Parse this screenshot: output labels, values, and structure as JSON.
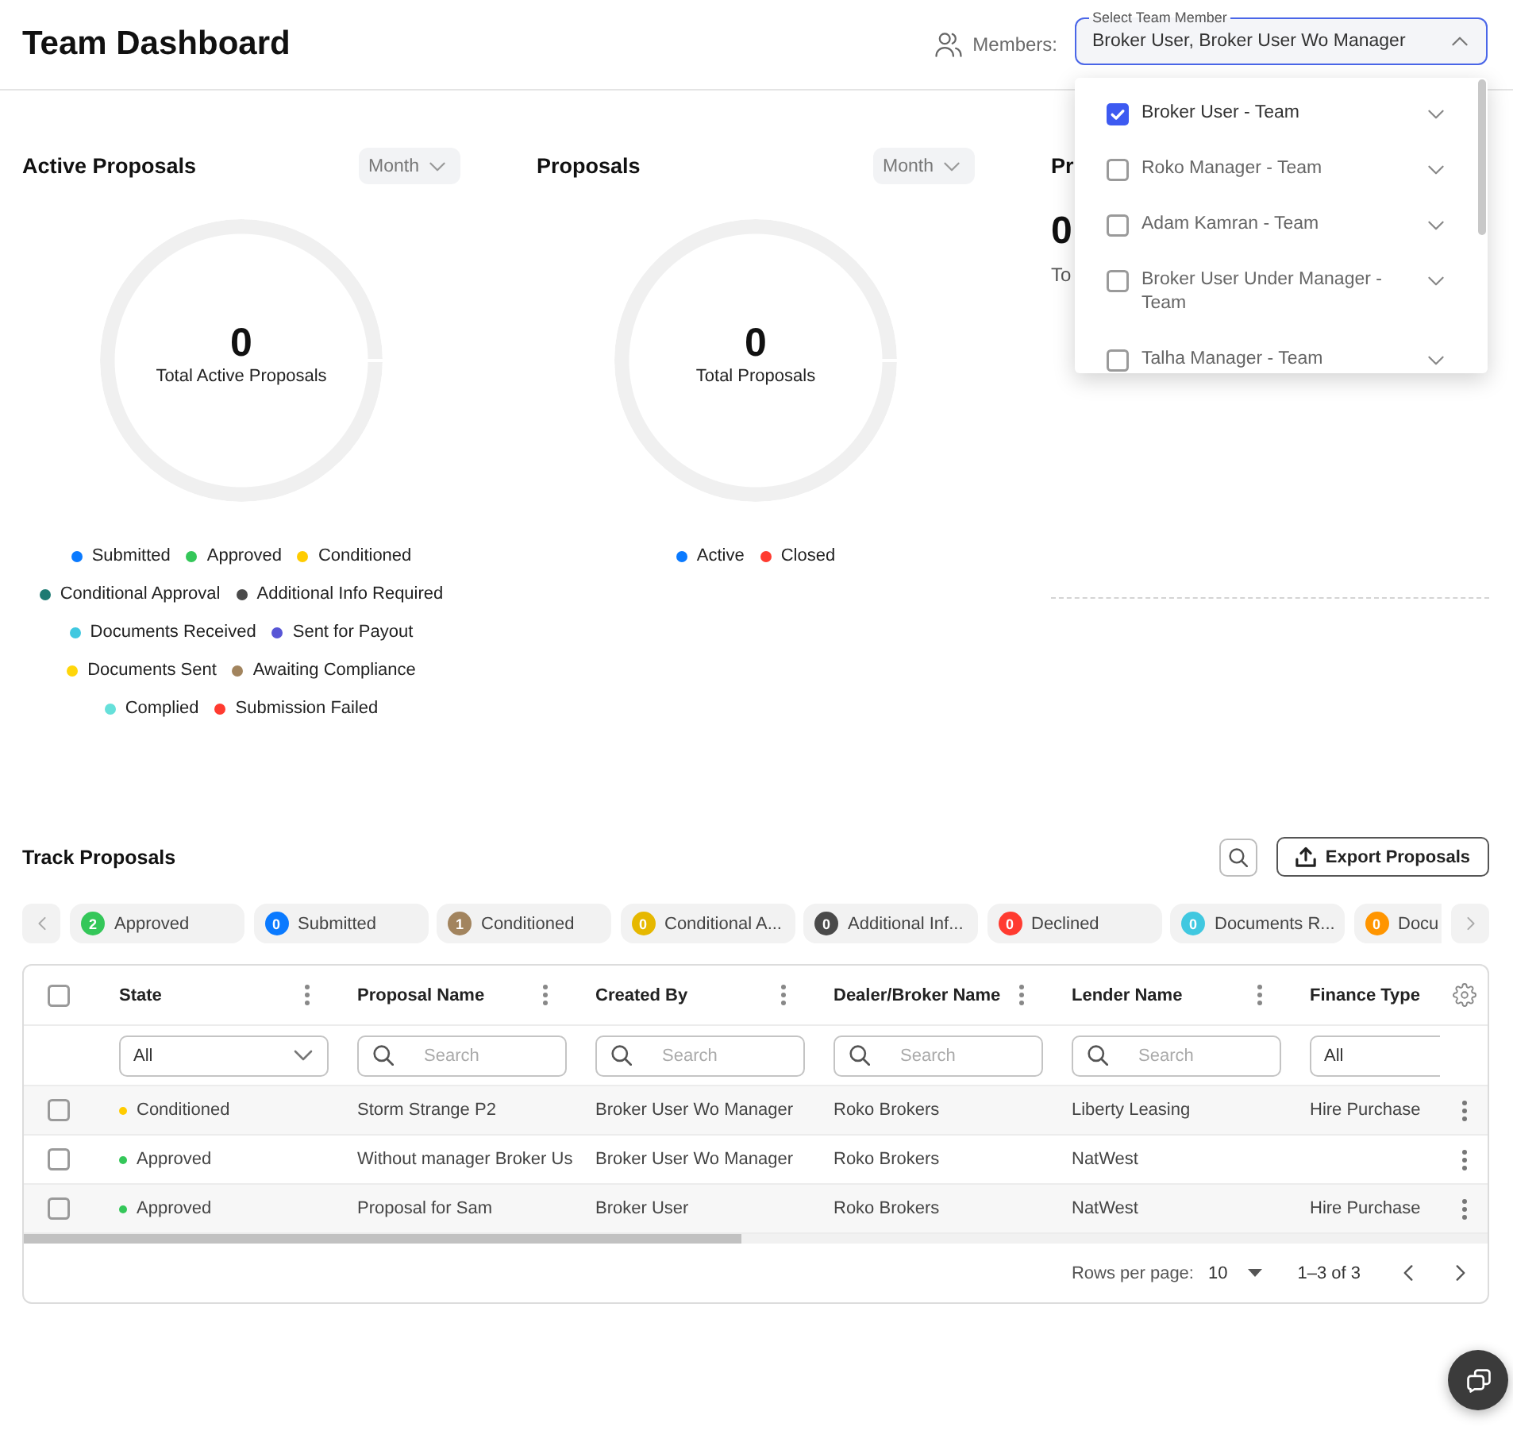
{
  "header": {
    "title": "Team Dashboard",
    "members_filter": {
      "label": "Members:",
      "field_label": "Select Team Member",
      "value": "Broker User, Broker User Wo Manager",
      "expanded": true,
      "options": [
        {
          "label": "Broker User - Team",
          "checked": true
        },
        {
          "label": "Roko Manager - Team",
          "checked": false
        },
        {
          "label": "Adam Kamran - Team",
          "checked": false
        },
        {
          "label": "Broker User Under Manager - Team",
          "checked": false
        },
        {
          "label": "Talha Manager - Team",
          "checked": false
        }
      ]
    }
  },
  "panels": [
    {
      "kind": "donut",
      "title": "Active Proposals",
      "period": "Month",
      "total": "0",
      "total_label": "Total Active Proposals",
      "legend": [
        {
          "label": "Submitted",
          "color": "#0a7aff"
        },
        {
          "label": "Approved",
          "color": "#34c759"
        },
        {
          "label": "Conditioned",
          "color": "#ffcc00"
        },
        {
          "label": "Conditional Approval",
          "color": "#1d7a72"
        },
        {
          "label": "Additional Info Required",
          "color": "#4a4a4a"
        },
        {
          "label": "Documents Received",
          "color": "#40c8e0"
        },
        {
          "label": "Sent for Payout",
          "color": "#5856d6"
        },
        {
          "label": "Documents Sent",
          "color": "#ffd60a"
        },
        {
          "label": "Awaiting Compliance",
          "color": "#a2845e"
        },
        {
          "label": "Complied",
          "color": "#66e0da"
        },
        {
          "label": "Submission Failed",
          "color": "#ff3b30"
        }
      ]
    },
    {
      "kind": "donut",
      "title": "Proposals",
      "period": "Month",
      "total": "0",
      "total_label": "Total Proposals",
      "legend": [
        {
          "label": "Active",
          "color": "#0a7aff"
        },
        {
          "label": "Closed",
          "color": "#ff3b30"
        }
      ]
    },
    {
      "kind": "stat",
      "title": "Pr",
      "total": "0",
      "total_label": "To"
    }
  ],
  "track_proposals": {
    "title": "Track Proposals",
    "export_label": "Export Proposals",
    "status_chips": [
      {
        "count": "2",
        "label": "Approved",
        "color": "#34c759"
      },
      {
        "count": "0",
        "label": "Submitted",
        "color": "#0a7aff"
      },
      {
        "count": "1",
        "label": "Conditioned",
        "color": "#a2845e"
      },
      {
        "count": "0",
        "label": "Conditional A...",
        "color": "#e6b800"
      },
      {
        "count": "0",
        "label": "Additional Inf...",
        "color": "#4a4a4a"
      },
      {
        "count": "0",
        "label": "Declined",
        "color": "#ff3b30"
      },
      {
        "count": "0",
        "label": "Documents R...",
        "color": "#40c8e0"
      },
      {
        "count": "0",
        "label": "Docu",
        "color": "#ff9500"
      }
    ],
    "table": {
      "all_checked": false,
      "columns": [
        {
          "label": "State",
          "filter": {
            "kind": "select",
            "value": "All"
          }
        },
        {
          "label": "Proposal Name",
          "filter": {
            "kind": "search",
            "placeholder": "Search"
          }
        },
        {
          "label": "Created By",
          "filter": {
            "kind": "search",
            "placeholder": "Search"
          }
        },
        {
          "label": "Dealer/Broker Name",
          "filter": {
            "kind": "search",
            "placeholder": "Search"
          }
        },
        {
          "label": "Lender Name",
          "filter": {
            "kind": "search",
            "placeholder": "Search"
          }
        },
        {
          "label": "Finance Type",
          "filter": {
            "kind": "select",
            "value": "All"
          }
        }
      ],
      "rows": [
        {
          "checked": false,
          "color": "#ffcc00",
          "cells": [
            "Conditioned",
            "Storm Strange P2",
            "Broker User Wo Manager",
            "Roko Brokers",
            "Liberty Leasing",
            "Hire Purchase"
          ]
        },
        {
          "checked": false,
          "color": "#34c759",
          "cells": [
            "Approved",
            "Without manager Broker Us",
            "Broker User Wo Manager",
            "Roko Brokers",
            "NatWest"
          ]
        },
        {
          "checked": false,
          "color": "#34c759",
          "cells": [
            "Approved",
            "Proposal for Sam",
            "Broker User",
            "Roko Brokers",
            "NatWest",
            "Hire Purchase"
          ]
        }
      ],
      "footer": {
        "rows_per_page_label": "Rows per page:",
        "rows_per_page": "10",
        "range": "1–3 of 3"
      }
    }
  }
}
